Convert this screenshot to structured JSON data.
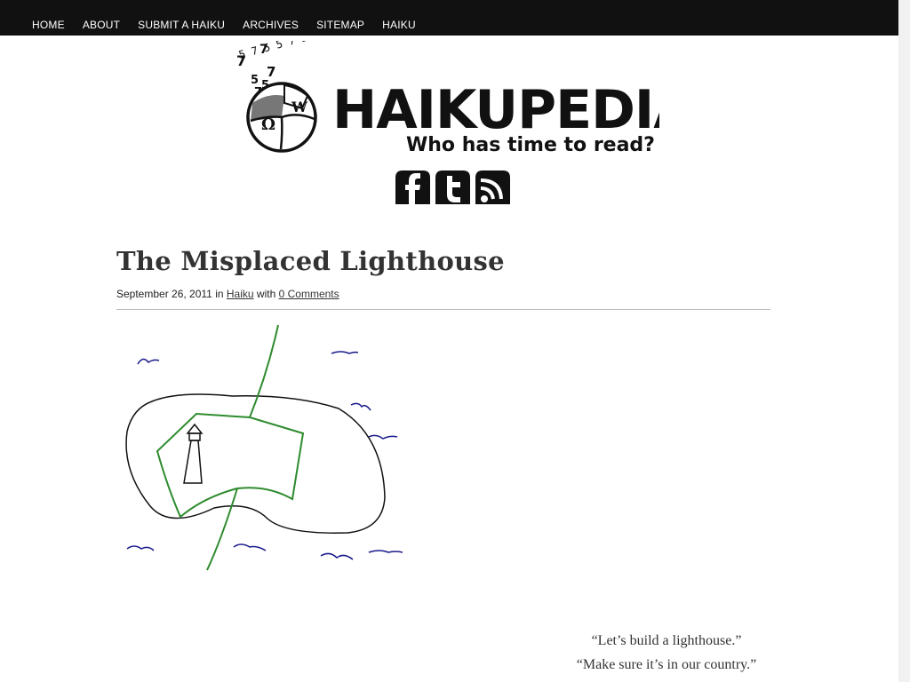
{
  "nav": {
    "items": [
      {
        "label": "HOME"
      },
      {
        "label": "ABOUT"
      },
      {
        "label": "SUBMIT A HAIKU"
      },
      {
        "label": "ARCHIVES"
      },
      {
        "label": "SITEMAP"
      },
      {
        "label": "HAIKU"
      }
    ]
  },
  "logo": {
    "title": "HAIKUPEDIA",
    "tagline": "Who has time to read?",
    "syllable_digits": "5 7 5 5 7 5 7 5"
  },
  "social": {
    "icons": [
      "facebook-icon",
      "twitter-icon",
      "rss-icon"
    ]
  },
  "post": {
    "title": "The Misplaced Lighthouse",
    "date": "September 26, 2011",
    "in_text": "in",
    "category": "Haiku",
    "with_text": "with",
    "comments": "0 Comments",
    "poem": [
      "“Let’s build a lighthouse.”",
      "“Make sure it’s in our country.”"
    ]
  },
  "colors": {
    "nav_bg": "#111111",
    "nav_text": "#ffffff",
    "title_text": "#333333",
    "border_green": "#2e8b2e",
    "wave_blue": "#1a1a8c"
  }
}
